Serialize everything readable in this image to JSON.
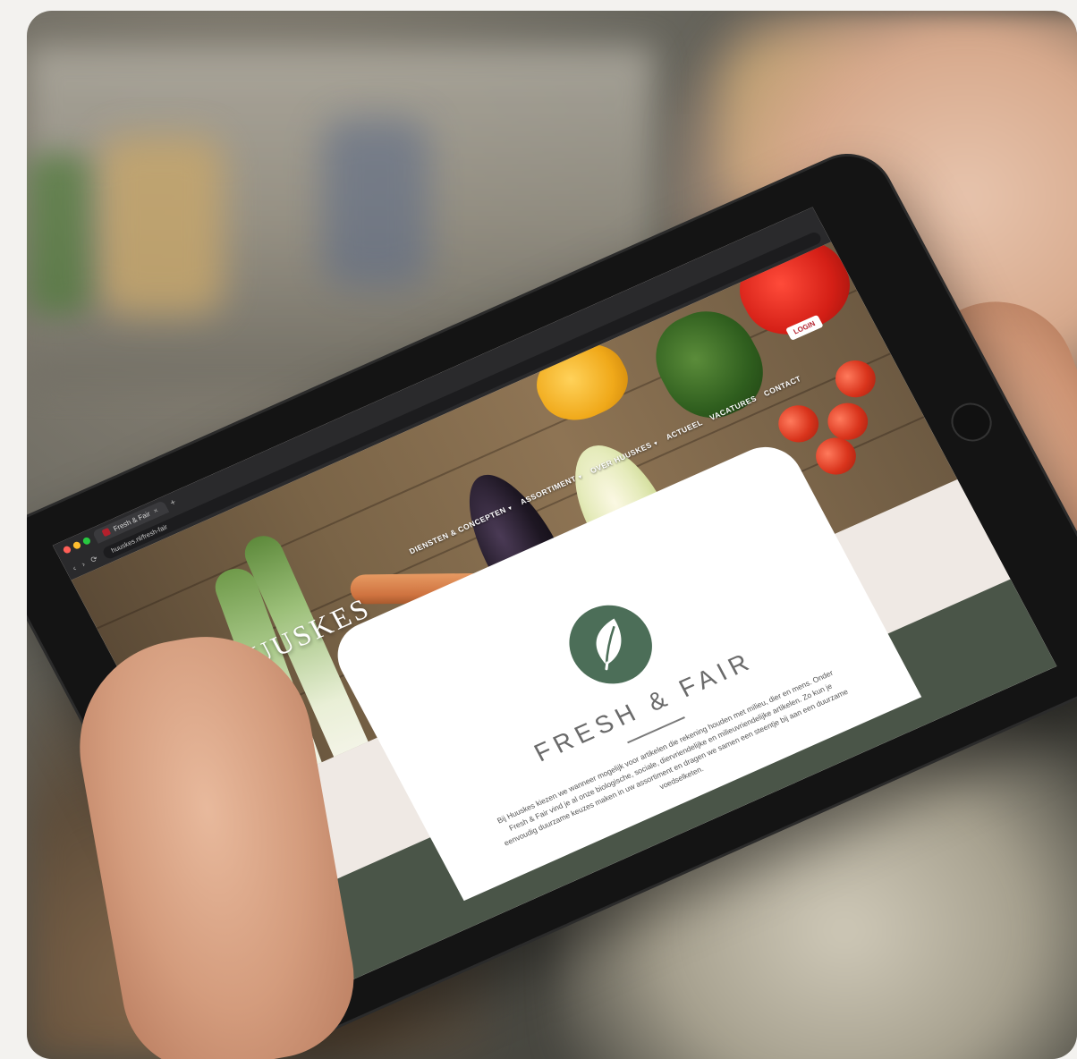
{
  "browser": {
    "tab_title": "Fresh & Fair",
    "tab_close": "×",
    "new_tab": "+",
    "url": "huuskes.nl/fresh-fair",
    "nav_back": "‹",
    "nav_forward": "›",
    "nav_reload": "⟳"
  },
  "site": {
    "logo_letter": "H",
    "logo_text": "HUUSKES",
    "login_label": "LOGIN",
    "nav": [
      "DIENSTEN & CONCEPTEN",
      "ASSORTIMENT",
      "OVER HUUSKES",
      "ACTUEEL",
      "VACATURES",
      "CONTACT"
    ]
  },
  "card": {
    "icon": "leaf-icon",
    "title": "FRESH & FAIR",
    "text": "Bij Huuskes kiezen we wanneer mogelijk voor artikelen die rekening houden met milieu, dier en mens. Onder Fresh & Fair vind je al onze biologische, sociale, diervriendelijke en milieuvriendelijke artikelen. Zo kun je eenvoudig duurzame keuzes maken in uw assortiment en dragen we samen een steentje bij aan een duurzame voedselketen."
  },
  "colors": {
    "brand_red": "#b3202c",
    "leaf_green": "#4c6e58",
    "band_green": "#4a5548"
  }
}
